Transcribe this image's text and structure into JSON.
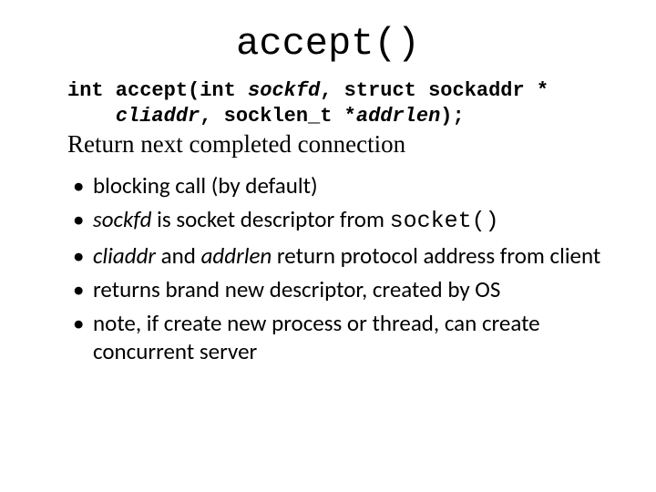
{
  "title": "accept()",
  "signature": {
    "l1a": "int accept(int ",
    "l1b": "sockfd",
    "l1c": ", struct sockaddr *",
    "l2a": "    ",
    "l2b": "cliaddr",
    "l2c": ", socklen_t *",
    "l2d": "addrlen",
    "l2e": ");"
  },
  "subtitle": "Return next completed connection",
  "bullets": {
    "b1": "blocking call (by default)",
    "b2a": "sockfd",
    "b2b": " is socket descriptor from ",
    "b2c": "socket()",
    "b3a": "cliaddr",
    "b3b": " and ",
    "b3c": "addrlen",
    "b3d": " return protocol address from client",
    "b4": "returns brand new descriptor, created by OS",
    "b5": "note, if create new process or thread, can create concurrent server"
  }
}
